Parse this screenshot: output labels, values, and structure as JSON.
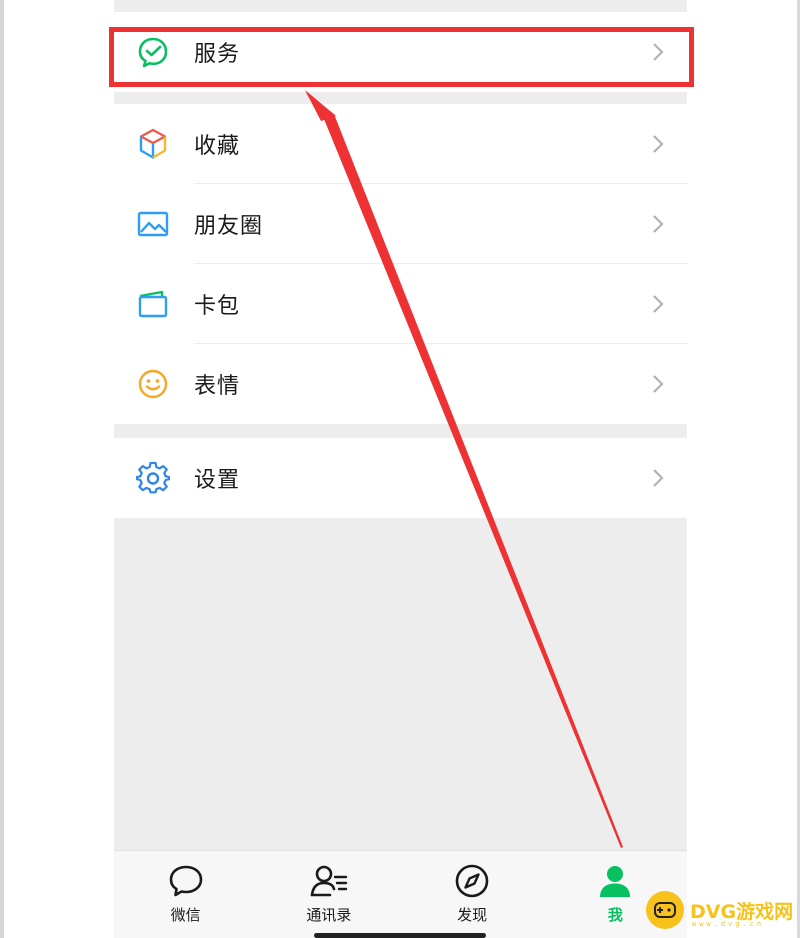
{
  "groups": [
    {
      "items": [
        {
          "label": "服务",
          "icon": "service-icon"
        }
      ]
    },
    {
      "items": [
        {
          "label": "收藏",
          "icon": "favorites-cube-icon"
        },
        {
          "label": "朋友圈",
          "icon": "moments-picture-icon"
        },
        {
          "label": "卡包",
          "icon": "card-wallet-icon"
        },
        {
          "label": "表情",
          "icon": "sticker-smiley-icon"
        }
      ]
    },
    {
      "items": [
        {
          "label": "设置",
          "icon": "settings-gear-icon"
        }
      ]
    }
  ],
  "tabbar": {
    "tabs": [
      {
        "label": "微信",
        "icon": "chat-bubble-icon",
        "active": false
      },
      {
        "label": "通讯录",
        "icon": "contacts-icon",
        "active": false
      },
      {
        "label": "发现",
        "icon": "compass-icon",
        "active": false
      },
      {
        "label": "我",
        "icon": "person-icon",
        "active": true
      }
    ]
  },
  "annotation": {
    "color": "#ee3233",
    "target": "服务"
  },
  "watermark": {
    "text": "DVG游戏网",
    "sub": "www.dvg.cn"
  },
  "colors": {
    "accent": "#07c160",
    "background": "#ededed",
    "annotation": "#ee3233"
  }
}
